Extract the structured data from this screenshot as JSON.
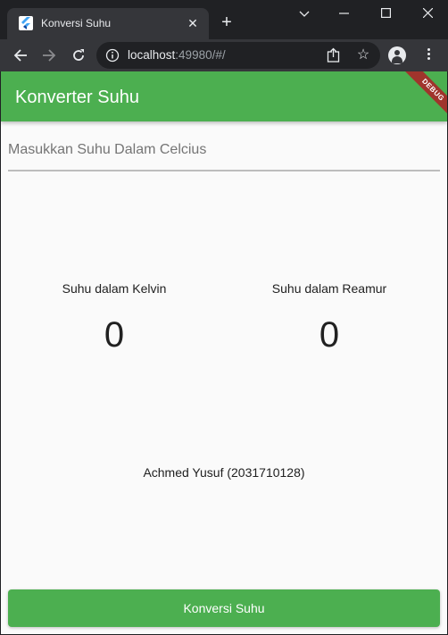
{
  "browser": {
    "tab_title": "Konversi Suhu",
    "url_host": "localhost",
    "url_rest": ":49980/#/",
    "icons": {
      "close": "close-icon",
      "new_tab": "plus-icon",
      "minimize": "minimize-icon",
      "maximize": "maximize-icon",
      "window_close": "close-icon",
      "back": "arrow-left-icon",
      "forward": "arrow-right-icon",
      "reload": "reload-icon",
      "info": "info-icon",
      "share": "share-icon",
      "star": "star-icon",
      "profile": "profile-icon",
      "menu": "more-vertical-icon",
      "favicon": "flutter-icon",
      "tab_search": "chevron-down-icon"
    }
  },
  "app": {
    "title": "Konverter Suhu",
    "debug_label": "DEBUG",
    "input": {
      "placeholder": "Masukkan Suhu Dalam Celcius",
      "value": ""
    },
    "kelvin": {
      "label": "Suhu dalam Kelvin",
      "value": "0"
    },
    "reamur": {
      "label": "Suhu dalam Reamur",
      "value": "0"
    },
    "author": "Achmed Yusuf (2031710128)",
    "button_label": "Konversi Suhu",
    "colors": {
      "primary": "#4caf50",
      "background": "#fafafa",
      "debug_banner": "#a0342c"
    }
  }
}
